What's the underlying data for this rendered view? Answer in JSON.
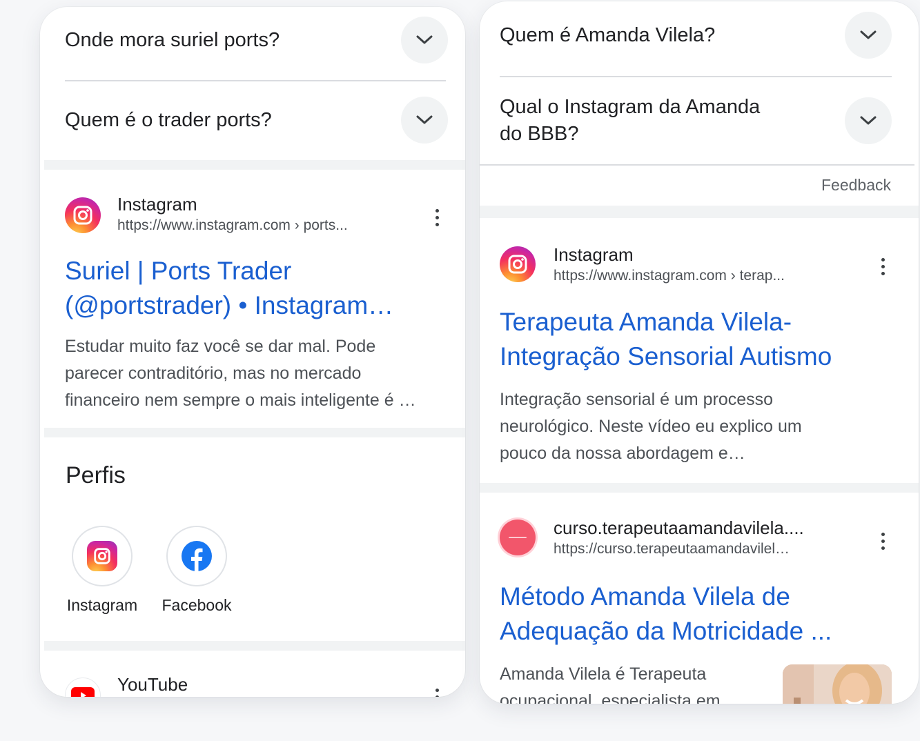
{
  "left_panel": {
    "faqs": [
      {
        "question": "Onde mora suriel ports?"
      },
      {
        "question": "Quem é o trader ports?"
      }
    ],
    "result": {
      "site_name": "Instagram",
      "url": "https://www.instagram.com › ports...",
      "title_line1": "Suriel | Ports Trader",
      "title_line2": "(@portstrader) • Instagram…",
      "snippet_line1": "Estudar muito faz você se dar mal. Pode",
      "snippet_line2": "parecer contraditório, mas no mercado",
      "snippet_line3": "financeiro nem sempre o mais inteligente é …"
    },
    "profiles": {
      "title": "Perfis",
      "items": [
        {
          "label": "Instagram",
          "icon": "instagram-icon"
        },
        {
          "label": "Facebook",
          "icon": "facebook-icon"
        }
      ]
    },
    "next_result": {
      "site_name": "YouTube"
    }
  },
  "right_panel": {
    "faqs": [
      {
        "question": "Quem é Amanda Vilela?"
      },
      {
        "question_line1": "Qual o Instagram da Amanda",
        "question_line2": "do BBB?"
      }
    ],
    "feedback": "Feedback",
    "result1": {
      "site_name": "Instagram",
      "url": "https://www.instagram.com › terap...",
      "title_line1": "Terapeuta Amanda Vilela-",
      "title_line2": "Integração Sensorial Autismo",
      "snippet_line1": "Integração sensorial é um processo",
      "snippet_line2": "neurológico. Neste vídeo eu explico um",
      "snippet_line3": "pouco da nossa abordagem e…"
    },
    "result2": {
      "site_name": "curso.terapeutaamandavilela....",
      "url": "https://curso.terapeutaamandavilel…",
      "title_line1": "Método Amanda Vilela de",
      "title_line2": "Adequação da Motricidade ...",
      "snippet_line1": "Amanda Vilela é Terapeuta",
      "snippet_line2": "ocupacional, especialista em"
    }
  },
  "colors": {
    "link_blue": "#1a5fd0",
    "instagram_gradient": "orange-pink-purple",
    "facebook_blue": "#1877f2",
    "youtube_red": "#ff0000"
  }
}
